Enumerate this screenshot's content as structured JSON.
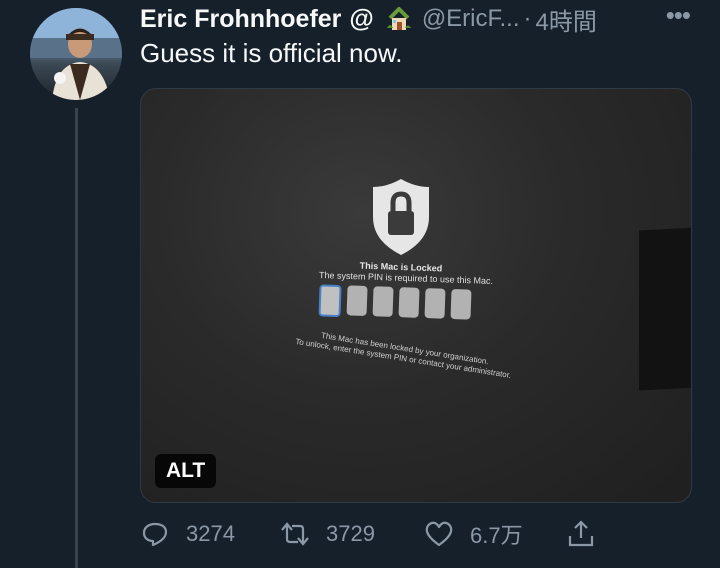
{
  "tweet": {
    "author_name": "Eric Frohnhoefer",
    "at_sign": "@",
    "handle": "@EricF...",
    "separator": "·",
    "time": "4時間",
    "text": "Guess it is official now."
  },
  "media": {
    "screen": {
      "title": "This Mac is Locked",
      "subtitle": "The system PIN is required to use this Mac.",
      "pin_boxes": 6,
      "org_line_1": "This Mac has been locked by your organization.",
      "org_line_2": "To unlock, enter the system PIN or contact your administrator."
    },
    "alt_label": "ALT"
  },
  "actions": {
    "reply_count": "3274",
    "retweet_count": "3729",
    "like_count": "6.7万"
  },
  "icons": {
    "more": "more-icon",
    "reply": "reply-icon",
    "retweet": "retweet-icon",
    "like": "heart-icon",
    "share": "share-icon",
    "house": "house-icon",
    "shield": "shield-lock-icon"
  },
  "colors": {
    "background": "#15202b",
    "secondary_text": "#8b98a5",
    "primary_text": "#f7f9f9"
  }
}
